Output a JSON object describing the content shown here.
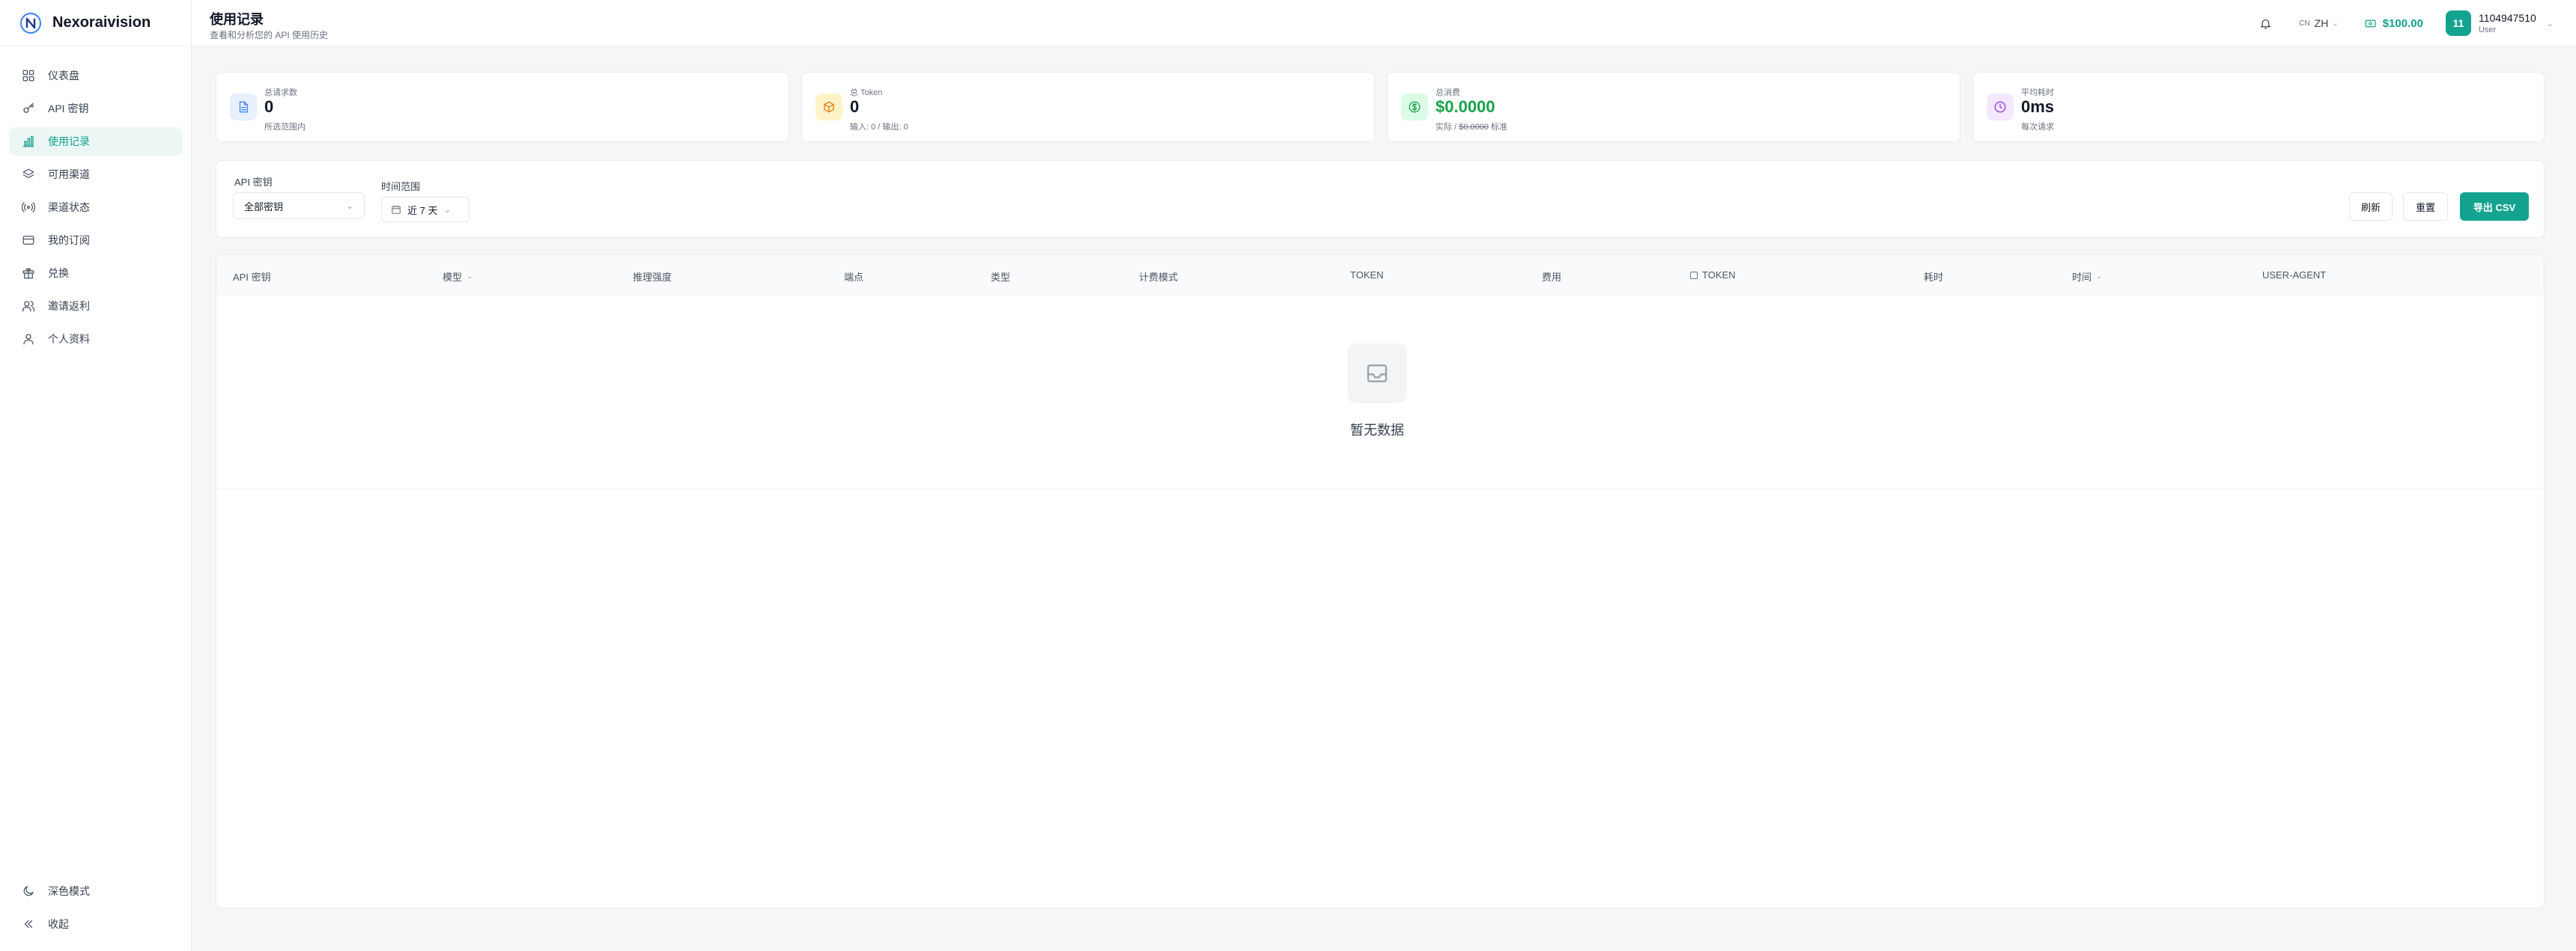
{
  "brand": {
    "name": "Nexoraivision"
  },
  "sidebar": {
    "items": [
      {
        "label": "仪表盘",
        "icon": "grid-icon"
      },
      {
        "label": "API 密钥",
        "icon": "key-icon"
      },
      {
        "label": "使用记录",
        "icon": "bar-chart-icon",
        "active": true
      },
      {
        "label": "可用渠道",
        "icon": "layers-icon"
      },
      {
        "label": "渠道状态",
        "icon": "signal-icon"
      },
      {
        "label": "我的订阅",
        "icon": "credit-card-icon"
      },
      {
        "label": "兑换",
        "icon": "gift-icon"
      },
      {
        "label": "邀请返利",
        "icon": "users-icon"
      },
      {
        "label": "个人资料",
        "icon": "user-icon"
      }
    ],
    "bottom": [
      {
        "label": "深色模式",
        "icon": "moon-icon"
      },
      {
        "label": "收起",
        "icon": "collapse-icon"
      }
    ]
  },
  "header": {
    "title": "使用记录",
    "subtitle": "查看和分析您的 API 使用历史",
    "lang_flag": "CN",
    "lang": "ZH",
    "balance": "$100.00",
    "user": {
      "avatar": "11",
      "name": "1104947510",
      "role": "User"
    }
  },
  "stats": [
    {
      "label": "总请求数",
      "value": "0",
      "sub": "所选范围内",
      "icon": "document-icon",
      "color": "#3b82f6",
      "bg": "#e8f0fe"
    },
    {
      "label": "总 Token",
      "value": "0",
      "sub": "输入: 0 / 输出: 0",
      "icon": "cube-icon",
      "color": "#d97706",
      "bg": "#fef3c7"
    },
    {
      "label": "总消费",
      "value": "$0.0000",
      "sub_prefix": "实际 / ",
      "sub_strike": "$0.0000",
      "sub_suffix": " 标准",
      "icon": "dollar-icon",
      "color": "#16a34a",
      "bg": "#dcfce7"
    },
    {
      "label": "平均耗时",
      "value": "0ms",
      "sub": "每次请求",
      "icon": "clock-icon",
      "color": "#9333ea",
      "bg": "#f3e8ff"
    }
  ],
  "filters": {
    "api_key_label": "API 密钥",
    "api_key_value": "全部密钥",
    "time_label": "时间范围",
    "time_value": "近 7 天",
    "refresh": "刷新",
    "reset": "重置",
    "export": "导出 CSV"
  },
  "table": {
    "columns": [
      "API 密钥",
      "模型",
      "推理强度",
      "端点",
      "类型",
      "计费模式",
      "TOKEN",
      "费用",
      "TOKEN",
      "耗时",
      "时间",
      "USER-AGENT"
    ],
    "empty": "暂无数据"
  },
  "colors": {
    "accent": "#14a38f"
  }
}
